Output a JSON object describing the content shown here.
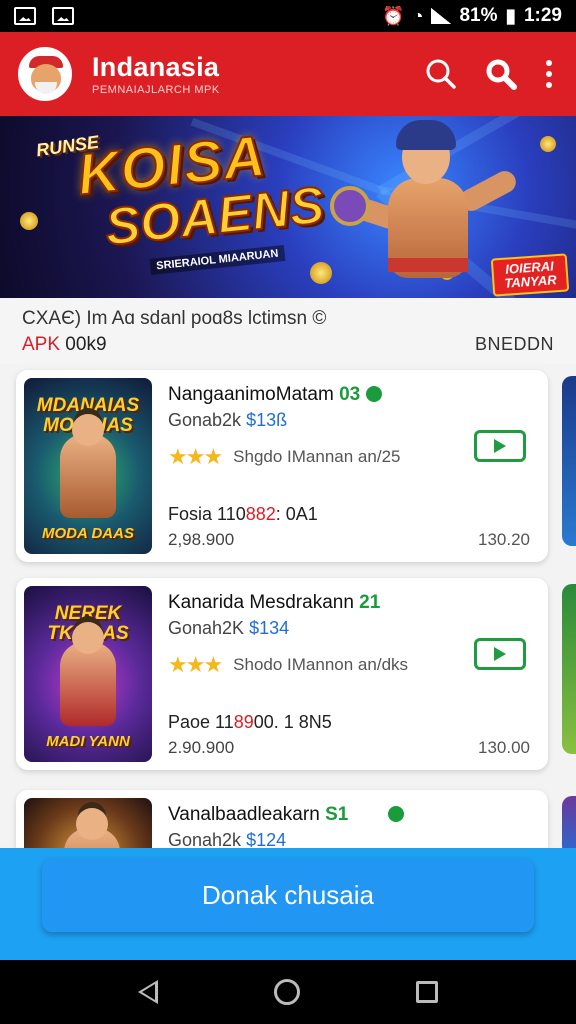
{
  "status_bar": {
    "battery": "81%",
    "time": "1:29"
  },
  "app_bar": {
    "title": "Indanasia",
    "subtitle": "PEMNAIAJLARCH MPK",
    "colors": {
      "primary": "#dc1f25"
    }
  },
  "banner": {
    "tag": "RUNSE",
    "title_line1": "KOISA",
    "title_line2": "SOAENS",
    "small_text": "SRIERAIOL MIAARUAN",
    "corner_badge": "IOIERAI TANYAR"
  },
  "section": {
    "title": "CXAЄ) Im Aɑ sdanl poɑ8s lctimsn ©",
    "tag_red": "APK",
    "tag_rest": " 00k9",
    "right_text": "BNEDDN"
  },
  "apps": [
    {
      "thumb_title": "MDANAIAS MODAIAS",
      "thumb_footer": "MODA DAAS",
      "name": "NangaanimoMatam",
      "name_tag": "03",
      "sub_prefix": "Gonab2k",
      "price": "$13ß",
      "rating_text": "Shgdo IMannan an/25",
      "meta_prefix": "Fosia 110",
      "meta_red": "882",
      "meta_suffix": ": 0A1",
      "downloads": "2,98.900",
      "size": "130.20"
    },
    {
      "thumb_title": "NEREK TKOOAS",
      "thumb_footer": "MADI YANN",
      "name": "Kanarida Mesdrakann",
      "name_tag": "21",
      "sub_prefix": "Gonah2K",
      "price": "$134",
      "rating_text": "Shodo IMannon an/dks",
      "meta_prefix": "Paoe 11",
      "meta_red": "89",
      "meta_suffix": "00. 1 8N5",
      "downloads": "2.90.900",
      "size": "130.00"
    },
    {
      "thumb_title": "",
      "thumb_footer": "",
      "name": "Vanalbaadleakarn",
      "name_tag": "S1",
      "sub_prefix": "Gonah2k",
      "price": "$124",
      "rating_text": "",
      "meta_prefix": "",
      "meta_red": "",
      "meta_suffix": "",
      "downloads": "",
      "size": ""
    }
  ],
  "cta": {
    "label": "Donak chusaia"
  }
}
